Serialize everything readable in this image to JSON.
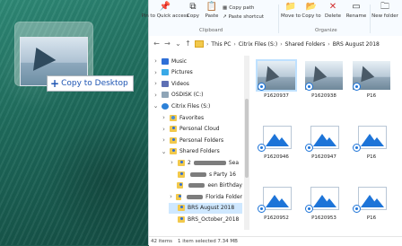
{
  "drag": {
    "tooltip_label": "Copy to Desktop",
    "tooltip_icon": "plus-icon"
  },
  "ribbon": {
    "buttons": [
      {
        "label": "Pin to Quick access",
        "icon": "pin-icon"
      },
      {
        "label": "Copy",
        "icon": "copy-icon"
      },
      {
        "label": "Paste",
        "icon": "paste-icon"
      }
    ],
    "small_buttons": [
      {
        "label": "Copy path",
        "icon": "copy-path-icon"
      },
      {
        "label": "Paste shortcut",
        "icon": "paste-shortcut-icon"
      }
    ],
    "organize_buttons": [
      {
        "label": "Move to",
        "icon": "move-icon"
      },
      {
        "label": "Copy to",
        "icon": "copy-to-icon"
      },
      {
        "label": "Delete",
        "icon": "delete-icon"
      },
      {
        "label": "Rename",
        "icon": "rename-icon"
      }
    ],
    "new_button": {
      "label": "New folder",
      "icon": "new-folder-icon"
    },
    "groups": {
      "clipboard": "Clipboard",
      "organize": "Organize"
    }
  },
  "address": {
    "crumbs": [
      "This PC",
      "Citrix Files (S:)",
      "Shared Folders",
      "BRS August 2018"
    ]
  },
  "nav": {
    "items": [
      {
        "label": "Music",
        "chevron": ">",
        "icon": "music-icon",
        "level": 1
      },
      {
        "label": "Pictures",
        "chevron": ">",
        "icon": "pictures-icon",
        "level": 1
      },
      {
        "label": "Videos",
        "chevron": ">",
        "icon": "videos-icon",
        "level": 1
      },
      {
        "label": "OSDISK (C:)",
        "chevron": ">",
        "icon": "drive-icon",
        "level": 1
      },
      {
        "label": "Citrix Files (S:)",
        "chevron": "v",
        "icon": "citrix-icon",
        "level": 1
      },
      {
        "label": "Favorites",
        "chevron": ">",
        "icon": "favorites-icon",
        "level": 2
      },
      {
        "label": "Personal Cloud",
        "chevron": ">",
        "icon": "folder-icon",
        "level": 2
      },
      {
        "label": "Personal Folders",
        "chevron": ">",
        "icon": "folder-icon",
        "level": 2
      },
      {
        "label": "Shared Folders",
        "chevron": "v",
        "icon": "folder-icon",
        "level": 2
      },
      {
        "label": "2",
        "suffix": "Sea",
        "chevron": ">",
        "icon": "folder-icon",
        "level": 3,
        "blur": 36
      },
      {
        "label": "",
        "suffix": "s Party 16",
        "chevron": "",
        "icon": "folder-icon",
        "level": 3,
        "blur": 18
      },
      {
        "label": "",
        "suffix": "een Birthday",
        "chevron": "",
        "icon": "folder-icon",
        "level": 3,
        "blur": 20
      },
      {
        "label": "",
        "suffix": "Florida Folder",
        "chevron": ">",
        "icon": "folder-icon",
        "level": 3,
        "blur": 26
      },
      {
        "label": "BRS August 2018",
        "chevron": "",
        "icon": "folder-icon",
        "level": 3,
        "selected": true
      },
      {
        "label": "BRS_October_2018",
        "chevron": "",
        "icon": "folder-icon",
        "level": 3
      }
    ]
  },
  "files": [
    {
      "name": "P1620937",
      "type": "photo",
      "selected": true
    },
    {
      "name": "P1620938",
      "type": "photo"
    },
    {
      "name": "P16",
      "type": "photo"
    },
    {
      "name": "P1620946",
      "type": "image"
    },
    {
      "name": "P1620947",
      "type": "image"
    },
    {
      "name": "P16",
      "type": "image"
    },
    {
      "name": "P1620952",
      "type": "image"
    },
    {
      "name": "P1620953",
      "type": "image"
    },
    {
      "name": "P16",
      "type": "image"
    }
  ],
  "status": {
    "items": "42 items",
    "selection": "1 item selected 7.34 MB"
  }
}
